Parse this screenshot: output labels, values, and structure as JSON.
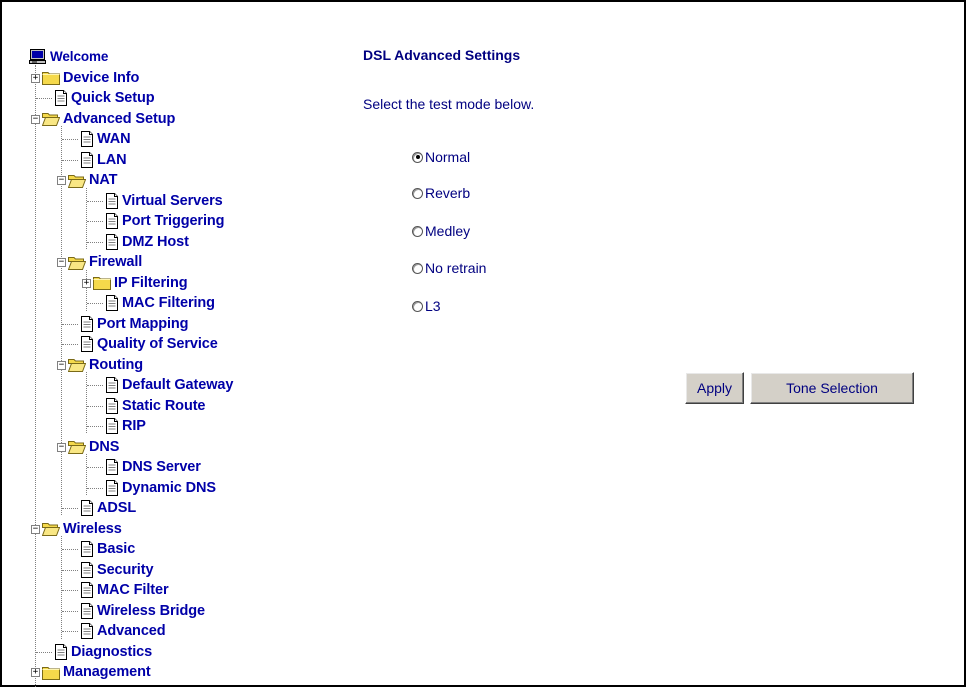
{
  "nav": {
    "welcome": "Welcome",
    "device_info": "Device Info",
    "quick_setup": "Quick Setup",
    "advanced_setup": "Advanced Setup",
    "wan": "WAN",
    "lan": "LAN",
    "nat": "NAT",
    "virtual_servers": "Virtual Servers",
    "port_triggering": "Port Triggering",
    "dmz_host": "DMZ Host",
    "firewall": "Firewall",
    "ip_filtering": "IP Filtering",
    "mac_filtering": "MAC Filtering",
    "port_mapping": "Port Mapping",
    "quality_of_service": "Quality of Service",
    "routing": "Routing",
    "default_gateway": "Default Gateway",
    "static_route": "Static Route",
    "rip": "RIP",
    "dns": "DNS",
    "dns_server": "DNS Server",
    "dynamic_dns": "Dynamic DNS",
    "adsl": "ADSL",
    "wireless": "Wireless",
    "basic": "Basic",
    "security": "Security",
    "mac_filter": "MAC Filter",
    "wireless_bridge": "Wireless Bridge",
    "advanced": "Advanced",
    "diagnostics": "Diagnostics",
    "management": "Management"
  },
  "toggles": {
    "expand": "+",
    "collapse": "−"
  },
  "main": {
    "title": "DSL Advanced Settings",
    "instructions": "Select the test mode below.",
    "test_modes": [
      {
        "label": "Normal",
        "checked": true
      },
      {
        "label": "Reverb",
        "checked": false
      },
      {
        "label": "Medley",
        "checked": false
      },
      {
        "label": "No retrain",
        "checked": false
      },
      {
        "label": "L3",
        "checked": false
      }
    ],
    "apply_label": "Apply",
    "tone_selection_label": "Tone Selection"
  },
  "colors": {
    "link": "#0000a8",
    "text": "#000080",
    "folder": "#f5d94b",
    "button_face": "#d4d0c8"
  },
  "icons": {
    "root": "computer-icon",
    "folder_closed": "folder-closed-icon",
    "folder_open": "folder-open-icon",
    "page": "page-icon"
  }
}
